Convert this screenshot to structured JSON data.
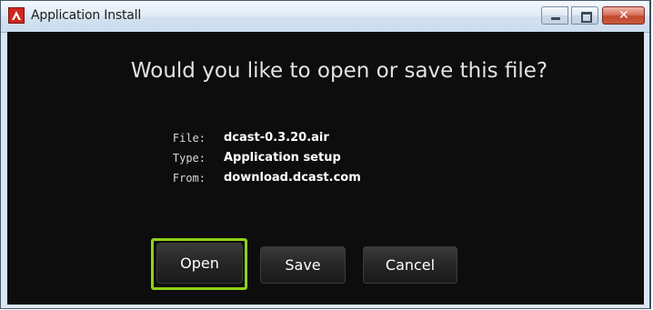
{
  "window": {
    "title": "Application Install",
    "controls": {
      "minimize_icon": "minimize-icon",
      "maximize_icon": "maximize-icon",
      "close_icon": "close-icon",
      "close_glyph": "✕"
    }
  },
  "dialog": {
    "heading": "Would you like to open or save this file?",
    "info": {
      "file_label": "File:",
      "file_value": "dcast-0.3.20.air",
      "type_label": "Type:",
      "type_value": "Application setup",
      "from_label": "From:",
      "from_value": "download.dcast.com"
    },
    "buttons": {
      "open": "Open",
      "save": "Save",
      "cancel": "Cancel"
    },
    "focused_button": "open"
  },
  "colors": {
    "content_bg": "#0d0d0d",
    "focus_ring": "#8fd21a",
    "app_icon": "#d0261e"
  }
}
